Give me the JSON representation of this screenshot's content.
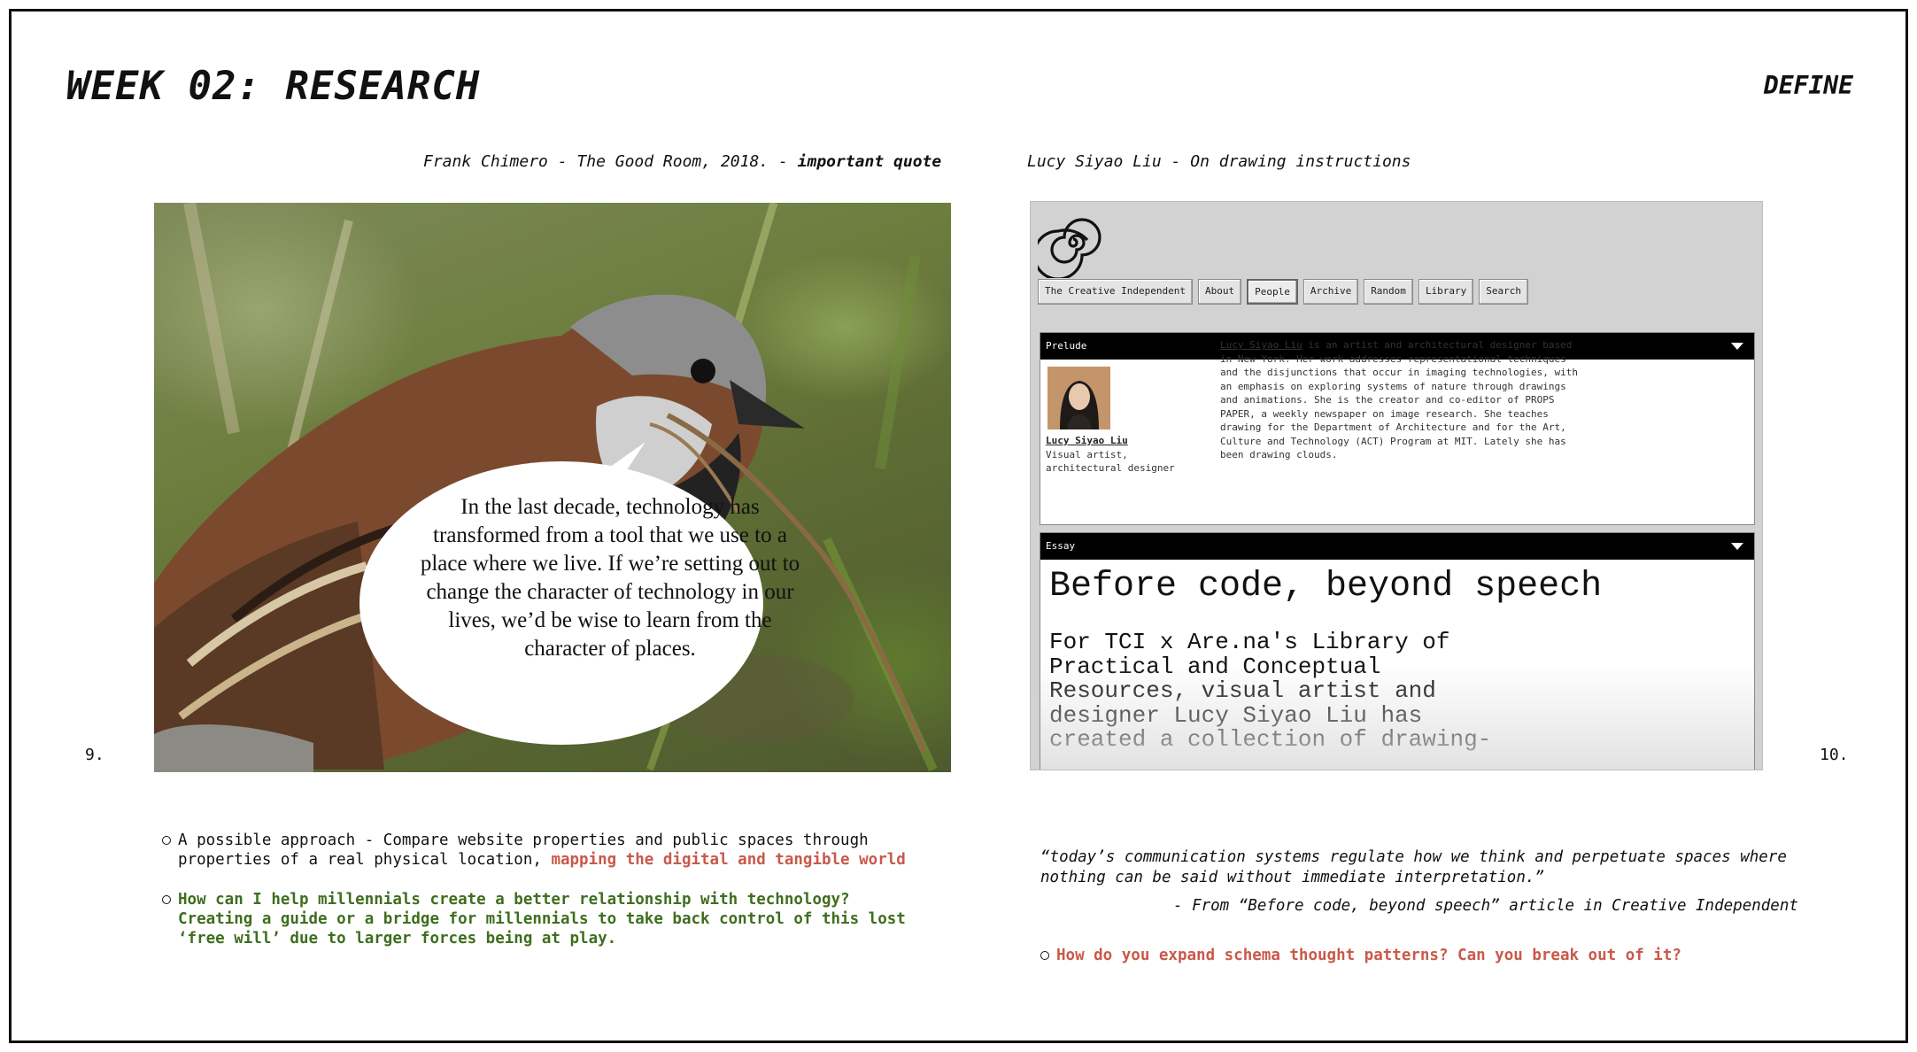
{
  "header": {
    "title": "WEEK 02: RESEARCH",
    "section": "DEFINE"
  },
  "left_panel": {
    "caption": "Frank Chimero - The Good Room, 2018. -",
    "caption_emphasis": "important quote",
    "quote": "In the last decade, technology has transformed from a tool that we use to a place where we live. If we’re setting out to change the character of technology in our lives, we’d be wise to learn from the character of places.",
    "page_number": "9."
  },
  "right_panel": {
    "caption": "Lucy Siyao Liu - On drawing instructions",
    "page_number": "10.",
    "nav": [
      {
        "label": "The Creative Independent",
        "active": false
      },
      {
        "label": "About",
        "active": false
      },
      {
        "label": "People",
        "active": true
      },
      {
        "label": "Archive",
        "active": false
      },
      {
        "label": "Random",
        "active": false
      },
      {
        "label": "Library",
        "active": false
      },
      {
        "label": "Search",
        "active": false
      }
    ],
    "prelude": {
      "bar_label": "Prelude",
      "name": "Lucy Siyao Liu",
      "role": "Visual artist, architectural designer",
      "bio_name": "Lucy Siyao Liu",
      "bio": " is an artist and architectural designer based in New York. Her work addresses representational techniques and the disjunctions that occur in imaging technologies, with an emphasis on exploring systems of nature through drawings and animations. She is the creator and co-editor of PROPS PAPER, a weekly newspaper on image research. She teaches drawing for the Department of Architecture and for the Art, Culture and Technology (ACT) Program at MIT. Lately she has been drawing clouds."
    },
    "essay": {
      "bar_label": "Essay",
      "title": "Before code, beyond speech",
      "body": "For TCI x Are.na's Library of Practical and Conceptual Resources, visual artist and designer Lucy Siyao Liu has created a collection of drawing-"
    }
  },
  "notes_left": {
    "bullet1_text": " A possible approach - Compare website properties and public spaces through properties of a real physical location,  ",
    "bullet1_highlight": "mapping the digital and tangible world",
    "bullet2_highlight": "How can I help millennials create a better relationship with technology? Creating a guide or a bridge for millennials to take back control of this lost ‘free will’ due to larger forces being at play."
  },
  "notes_right": {
    "quote": "“today’s communication systems regulate how we think and perpetuate spaces where nothing can be said without immediate interpretation.”",
    "attribution": "- From “Before code, beyond speech” article in Creative Independent",
    "question": "How do you expand schema thought patterns? Can you break out of it?"
  },
  "colors": {
    "red": "#c9594a",
    "green": "#3f6e1e",
    "ink": "#111111"
  }
}
